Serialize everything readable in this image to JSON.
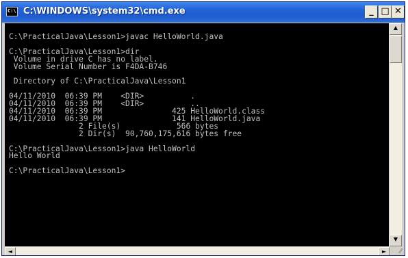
{
  "window": {
    "title": "C:\\WINDOWS\\system32\\cmd.exe",
    "icon_label": "C:\\",
    "buttons": {
      "minimize": "_",
      "maximize": "□",
      "close": "✕"
    }
  },
  "console": {
    "lines": [
      "",
      "C:\\PracticalJava\\Lesson1>javac HelloWorld.java",
      "",
      "C:\\PracticalJava\\Lesson1>dir",
      " Volume in drive C has no label.",
      " Volume Serial Number is F4DA-B746",
      "",
      " Directory of C:\\PracticalJava\\Lesson1",
      "",
      "04/11/2010  06:39 PM    <DIR>          .",
      "04/11/2010  06:39 PM    <DIR>          ..",
      "04/11/2010  06:39 PM               425 HelloWorld.class",
      "04/11/2010  06:39 PM               141 HelloWorld.java",
      "               2 File(s)            566 bytes",
      "               2 Dir(s)  90,760,175,616 bytes free",
      "",
      "C:\\PracticalJava\\Lesson1>java HelloWorld",
      "Hello World",
      "",
      "C:\\PracticalJava\\Lesson1>"
    ]
  },
  "scrollbars": {
    "up_arrow": "▲",
    "down_arrow": "▼",
    "left_arrow": "◄",
    "right_arrow": "►",
    "grip": "⁄⁄"
  },
  "colors": {
    "titlebar": "#2365d8",
    "console_bg": "#000000",
    "console_text": "#c0c0c0"
  }
}
